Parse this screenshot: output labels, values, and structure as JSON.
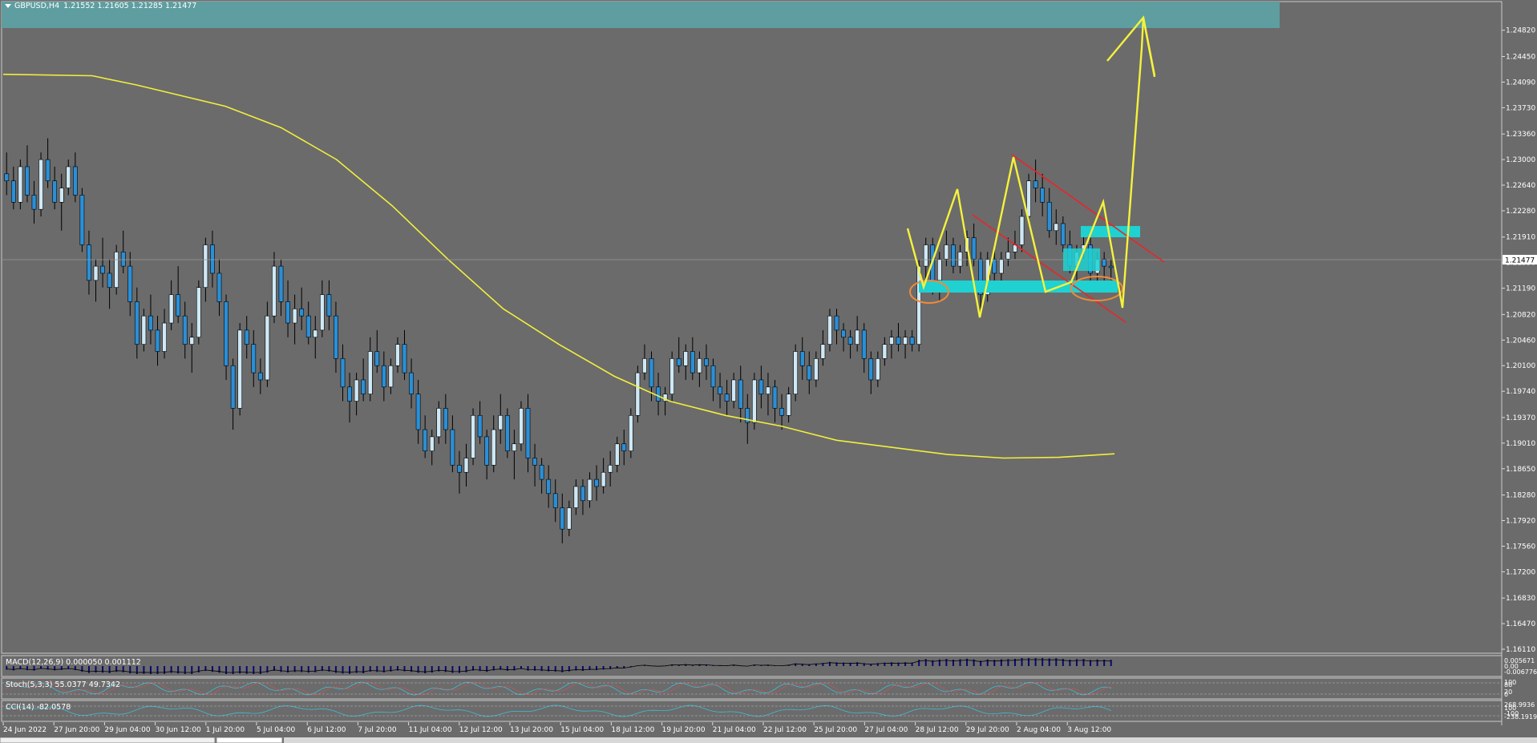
{
  "window": {
    "symbol_label": "GBPUSD,H4",
    "ohlc": "1.21552 1.21605 1.21285 1.21477"
  },
  "price_axis": {
    "labels": [
      "1.24820",
      "1.24450",
      "1.24090",
      "1.23730",
      "1.23360",
      "1.23000",
      "1.22640",
      "1.22280",
      "1.21910",
      "1.21550",
      "1.21190",
      "1.20820",
      "1.20460",
      "1.20100",
      "1.19740",
      "1.19370",
      "1.19010",
      "1.18650",
      "1.18280",
      "1.17920",
      "1.17560",
      "1.17200",
      "1.16830",
      "1.16470",
      "1.16110"
    ],
    "current_price": "1.21477"
  },
  "time_axis": {
    "labels": [
      "24 Jun 2022",
      "27 Jun 20:00",
      "29 Jun 04:00",
      "30 Jun 12:00",
      "1 Jul 20:00",
      "5 Jul 04:00",
      "6 Jul 12:00",
      "7 Jul 20:00",
      "11 Jul 04:00",
      "12 Jul 12:00",
      "13 Jul 20:00",
      "15 Jul 04:00",
      "18 Jul 12:00",
      "19 Jul 20:00",
      "21 Jul 04:00",
      "22 Jul 12:00",
      "25 Jul 20:00",
      "27 Jul 04:00",
      "28 Jul 12:00",
      "29 Jul 20:00",
      "2 Aug 04:00",
      "3 Aug 12:00"
    ]
  },
  "indicators": {
    "macd": {
      "label": "MACD(12,26,9) 0.000050 0.001112",
      "axis": [
        "0.005671",
        "0.00",
        "-0.006776"
      ]
    },
    "stoch": {
      "label": "Stoch(5,3,3) 55.0377 49.7342",
      "axis": [
        "100",
        "80",
        "20",
        "0"
      ]
    },
    "cci": {
      "label": "CCI(14) -82.0578",
      "axis": [
        "268.9936",
        "100",
        "-100",
        "-238.1919"
      ]
    }
  },
  "colors": {
    "background": "#6b6b6b",
    "bull_candle": "#cfe8f5",
    "bear_candle": "#2b8fd6",
    "moving_average": "#f2ef3c",
    "cyan_zone": "#1fd1d1",
    "teal_zone": "#5f9ea0",
    "trend_lines": "#e8262a",
    "ellipses": "#f08a3a",
    "drawing_zigzag": "#f5f23c",
    "macd_hist": "#0a0a6e",
    "stoch_main": "#3fbcd6",
    "stoch_signal": "#e05050",
    "cci_line": "#3fbcd6",
    "current_price_label": "#ffffff"
  },
  "chart_data": {
    "type": "candlestick",
    "symbol": "GBPUSD",
    "timeframe": "H4",
    "ylim": [
      1.1611,
      1.2502
    ],
    "candles": [
      [
        1.228,
        1.231,
        1.225,
        1.227
      ],
      [
        1.227,
        1.229,
        1.223,
        1.224
      ],
      [
        1.224,
        1.23,
        1.223,
        1.229
      ],
      [
        1.229,
        1.232,
        1.224,
        1.225
      ],
      [
        1.225,
        1.227,
        1.221,
        1.223
      ],
      [
        1.223,
        1.231,
        1.222,
        1.23
      ],
      [
        1.23,
        1.233,
        1.226,
        1.227
      ],
      [
        1.227,
        1.229,
        1.223,
        1.224
      ],
      [
        1.224,
        1.228,
        1.22,
        1.226
      ],
      [
        1.226,
        1.23,
        1.225,
        1.229
      ],
      [
        1.229,
        1.231,
        1.224,
        1.225
      ],
      [
        1.225,
        1.226,
        1.217,
        1.218
      ],
      [
        1.218,
        1.22,
        1.211,
        1.213
      ],
      [
        1.213,
        1.216,
        1.21,
        1.215
      ],
      [
        1.215,
        1.219,
        1.212,
        1.214
      ],
      [
        1.214,
        1.216,
        1.209,
        1.212
      ],
      [
        1.212,
        1.218,
        1.211,
        1.217
      ],
      [
        1.217,
        1.22,
        1.214,
        1.215
      ],
      [
        1.215,
        1.217,
        1.208,
        1.21
      ],
      [
        1.21,
        1.212,
        1.202,
        1.204
      ],
      [
        1.204,
        1.209,
        1.203,
        1.208
      ],
      [
        1.208,
        1.211,
        1.204,
        1.206
      ],
      [
        1.206,
        1.208,
        1.201,
        1.203
      ],
      [
        1.203,
        1.209,
        1.202,
        1.207
      ],
      [
        1.207,
        1.213,
        1.206,
        1.211
      ],
      [
        1.211,
        1.215,
        1.207,
        1.208
      ],
      [
        1.208,
        1.21,
        1.202,
        1.204
      ],
      [
        1.204,
        1.207,
        1.2,
        1.205
      ],
      [
        1.205,
        1.213,
        1.204,
        1.212
      ],
      [
        1.212,
        1.219,
        1.21,
        1.218
      ],
      [
        1.218,
        1.22,
        1.212,
        1.214
      ],
      [
        1.214,
        1.216,
        1.208,
        1.21
      ],
      [
        1.21,
        1.211,
        1.199,
        1.201
      ],
      [
        1.201,
        1.202,
        1.192,
        1.195
      ],
      [
        1.195,
        1.207,
        1.194,
        1.206
      ],
      [
        1.206,
        1.208,
        1.202,
        1.204
      ],
      [
        1.204,
        1.206,
        1.198,
        1.2
      ],
      [
        1.2,
        1.202,
        1.197,
        1.199
      ],
      [
        1.199,
        1.21,
        1.198,
        1.208
      ],
      [
        1.208,
        1.217,
        1.207,
        1.215
      ],
      [
        1.215,
        1.216,
        1.208,
        1.21
      ],
      [
        1.21,
        1.213,
        1.205,
        1.207
      ],
      [
        1.207,
        1.211,
        1.204,
        1.209
      ],
      [
        1.209,
        1.212,
        1.206,
        1.208
      ],
      [
        1.208,
        1.21,
        1.204,
        1.205
      ],
      [
        1.205,
        1.208,
        1.202,
        1.206
      ],
      [
        1.206,
        1.213,
        1.205,
        1.211
      ],
      [
        1.211,
        1.213,
        1.206,
        1.208
      ],
      [
        1.208,
        1.21,
        1.2,
        1.202
      ],
      [
        1.202,
        1.204,
        1.196,
        1.198
      ],
      [
        1.198,
        1.2,
        1.193,
        1.196
      ],
      [
        1.196,
        1.2,
        1.194,
        1.199
      ],
      [
        1.199,
        1.202,
        1.196,
        1.197
      ],
      [
        1.197,
        1.205,
        1.196,
        1.203
      ],
      [
        1.203,
        1.206,
        1.2,
        1.201
      ],
      [
        1.201,
        1.203,
        1.196,
        1.198
      ],
      [
        1.198,
        1.202,
        1.197,
        1.201
      ],
      [
        1.201,
        1.205,
        1.2,
        1.204
      ],
      [
        1.204,
        1.206,
        1.199,
        1.2
      ],
      [
        1.2,
        1.202,
        1.195,
        1.197
      ],
      [
        1.197,
        1.199,
        1.19,
        1.192
      ],
      [
        1.192,
        1.194,
        1.188,
        1.189
      ],
      [
        1.189,
        1.192,
        1.187,
        1.191
      ],
      [
        1.191,
        1.196,
        1.19,
        1.195
      ],
      [
        1.195,
        1.197,
        1.19,
        1.192
      ],
      [
        1.192,
        1.194,
        1.186,
        1.187
      ],
      [
        1.187,
        1.189,
        1.183,
        1.186
      ],
      [
        1.186,
        1.19,
        1.184,
        1.188
      ],
      [
        1.188,
        1.195,
        1.187,
        1.194
      ],
      [
        1.194,
        1.196,
        1.19,
        1.191
      ],
      [
        1.191,
        1.192,
        1.185,
        1.187
      ],
      [
        1.187,
        1.194,
        1.186,
        1.192
      ],
      [
        1.192,
        1.197,
        1.19,
        1.194
      ],
      [
        1.194,
        1.195,
        1.188,
        1.189
      ],
      [
        1.189,
        1.192,
        1.185,
        1.19
      ],
      [
        1.19,
        1.196,
        1.189,
        1.195
      ],
      [
        1.195,
        1.197,
        1.186,
        1.188
      ],
      [
        1.188,
        1.19,
        1.184,
        1.187
      ],
      [
        1.187,
        1.188,
        1.183,
        1.185
      ],
      [
        1.185,
        1.187,
        1.181,
        1.183
      ],
      [
        1.183,
        1.185,
        1.179,
        1.181
      ],
      [
        1.181,
        1.183,
        1.176,
        1.178
      ],
      [
        1.178,
        1.182,
        1.177,
        1.181
      ],
      [
        1.181,
        1.185,
        1.18,
        1.184
      ],
      [
        1.184,
        1.185,
        1.18,
        1.182
      ],
      [
        1.182,
        1.186,
        1.181,
        1.185
      ],
      [
        1.185,
        1.187,
        1.182,
        1.184
      ],
      [
        1.184,
        1.188,
        1.183,
        1.186
      ],
      [
        1.186,
        1.189,
        1.184,
        1.187
      ],
      [
        1.187,
        1.191,
        1.186,
        1.19
      ],
      [
        1.19,
        1.192,
        1.187,
        1.189
      ],
      [
        1.189,
        1.195,
        1.188,
        1.194
      ],
      [
        1.194,
        1.201,
        1.193,
        1.2
      ],
      [
        1.2,
        1.204,
        1.199,
        1.202
      ],
      [
        1.202,
        1.203,
        1.196,
        1.198
      ],
      [
        1.198,
        1.2,
        1.194,
        1.196
      ],
      [
        1.196,
        1.198,
        1.194,
        1.197
      ],
      [
        1.197,
        1.203,
        1.196,
        1.202
      ],
      [
        1.202,
        1.205,
        1.2,
        1.201
      ],
      [
        1.201,
        1.204,
        1.199,
        1.203
      ],
      [
        1.203,
        1.205,
        1.199,
        1.2
      ],
      [
        1.2,
        1.203,
        1.198,
        1.202
      ],
      [
        1.202,
        1.204,
        1.199,
        1.201
      ],
      [
        1.201,
        1.202,
        1.196,
        1.198
      ],
      [
        1.198,
        1.2,
        1.195,
        1.197
      ],
      [
        1.197,
        1.199,
        1.194,
        1.196
      ],
      [
        1.196,
        1.2,
        1.195,
        1.199
      ],
      [
        1.199,
        1.201,
        1.193,
        1.195
      ],
      [
        1.195,
        1.197,
        1.19,
        1.193
      ],
      [
        1.193,
        1.2,
        1.192,
        1.199
      ],
      [
        1.199,
        1.201,
        1.195,
        1.197
      ],
      [
        1.197,
        1.2,
        1.194,
        1.198
      ],
      [
        1.198,
        1.199,
        1.193,
        1.195
      ],
      [
        1.195,
        1.197,
        1.192,
        1.194
      ],
      [
        1.194,
        1.198,
        1.193,
        1.197
      ],
      [
        1.197,
        1.204,
        1.196,
        1.203
      ],
      [
        1.203,
        1.205,
        1.199,
        1.201
      ],
      [
        1.201,
        1.203,
        1.197,
        1.199
      ],
      [
        1.199,
        1.203,
        1.198,
        1.202
      ],
      [
        1.202,
        1.206,
        1.201,
        1.204
      ],
      [
        1.204,
        1.209,
        1.203,
        1.208
      ],
      [
        1.208,
        1.209,
        1.204,
        1.206
      ],
      [
        1.206,
        1.207,
        1.203,
        1.205
      ],
      [
        1.205,
        1.206,
        1.202,
        1.204
      ],
      [
        1.204,
        1.208,
        1.203,
        1.206
      ],
      [
        1.206,
        1.207,
        1.2,
        1.202
      ],
      [
        1.202,
        1.203,
        1.197,
        1.199
      ],
      [
        1.199,
        1.203,
        1.198,
        1.202
      ],
      [
        1.202,
        1.205,
        1.201,
        1.204
      ],
      [
        1.204,
        1.206,
        1.202,
        1.205
      ],
      [
        1.205,
        1.207,
        1.203,
        1.204
      ],
      [
        1.204,
        1.206,
        1.202,
        1.205
      ],
      [
        1.205,
        1.206,
        1.203,
        1.204
      ],
      [
        1.204,
        1.216,
        1.203,
        1.215
      ],
      [
        1.215,
        1.219,
        1.212,
        1.218
      ],
      [
        1.218,
        1.219,
        1.211,
        1.213
      ],
      [
        1.213,
        1.217,
        1.21,
        1.216
      ],
      [
        1.216,
        1.22,
        1.215,
        1.218
      ],
      [
        1.218,
        1.219,
        1.214,
        1.215
      ],
      [
        1.215,
        1.218,
        1.214,
        1.217
      ],
      [
        1.217,
        1.22,
        1.215,
        1.219
      ],
      [
        1.219,
        1.221,
        1.215,
        1.216
      ],
      [
        1.216,
        1.217,
        1.209,
        1.211
      ],
      [
        1.211,
        1.217,
        1.21,
        1.216
      ],
      [
        1.216,
        1.218,
        1.213,
        1.214
      ],
      [
        1.214,
        1.217,
        1.212,
        1.216
      ],
      [
        1.216,
        1.219,
        1.215,
        1.217
      ],
      [
        1.217,
        1.22,
        1.216,
        1.218
      ],
      [
        1.218,
        1.223,
        1.217,
        1.222
      ],
      [
        1.222,
        1.228,
        1.221,
        1.227
      ],
      [
        1.227,
        1.23,
        1.224,
        1.226
      ],
      [
        1.226,
        1.228,
        1.222,
        1.224
      ],
      [
        1.224,
        1.226,
        1.219,
        1.22
      ],
      [
        1.22,
        1.223,
        1.218,
        1.221
      ],
      [
        1.221,
        1.222,
        1.217,
        1.218
      ],
      [
        1.218,
        1.22,
        1.214,
        1.215
      ],
      [
        1.215,
        1.218,
        1.213,
        1.217
      ],
      [
        1.217,
        1.22,
        1.216,
        1.218
      ],
      [
        1.218,
        1.219,
        1.213,
        1.214
      ],
      [
        1.214,
        1.217,
        1.212,
        1.216
      ],
      [
        1.216,
        1.217,
        1.213,
        1.215
      ],
      [
        1.215,
        1.216,
        1.213,
        1.2148
      ]
    ],
    "moving_average": [
      [
        0,
        1.242
      ],
      [
        0.08,
        1.2418
      ],
      [
        0.12,
        1.2405
      ],
      [
        0.2,
        1.2375
      ],
      [
        0.25,
        1.2345
      ],
      [
        0.3,
        1.23
      ],
      [
        0.35,
        1.2235
      ],
      [
        0.4,
        1.216
      ],
      [
        0.45,
        1.209
      ],
      [
        0.5,
        1.204
      ],
      [
        0.55,
        1.1995
      ],
      [
        0.6,
        1.196
      ],
      [
        0.65,
        1.194
      ],
      [
        0.7,
        1.1925
      ],
      [
        0.75,
        1.1905
      ],
      [
        0.8,
        1.1895
      ],
      [
        0.85,
        1.1885
      ],
      [
        0.9,
        1.188
      ],
      [
        0.95,
        1.1881
      ],
      [
        1.0,
        1.1886
      ]
    ]
  }
}
